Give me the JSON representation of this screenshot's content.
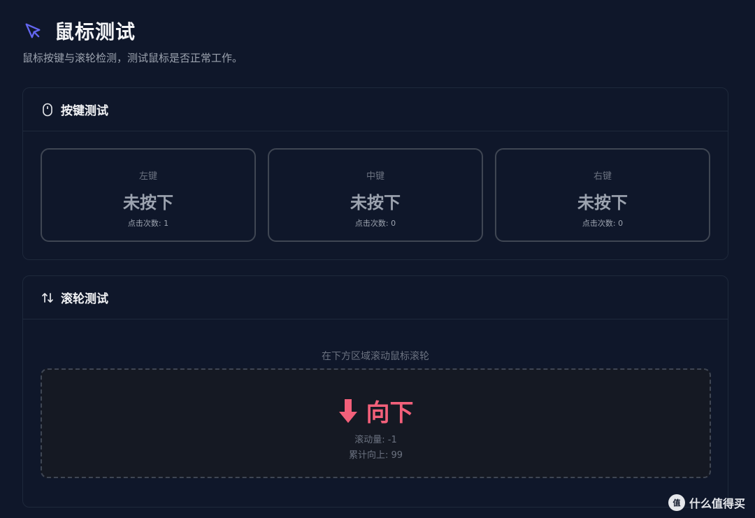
{
  "header": {
    "icon": "cursor-arrow-icon",
    "title": "鼠标测试",
    "subtitle": "鼠标按键与滚轮检测，测试鼠标是否正常工作。"
  },
  "button_test": {
    "icon": "mouse-icon",
    "title": "按键测试",
    "buttons": [
      {
        "name": "左键",
        "state": "未按下",
        "count": "点击次数: 1"
      },
      {
        "name": "中键",
        "state": "未按下",
        "count": "点击次数: 0"
      },
      {
        "name": "右键",
        "state": "未按下",
        "count": "点击次数: 0"
      }
    ]
  },
  "wheel_test": {
    "icon": "up-down-arrows-icon",
    "title": "滚轮测试",
    "hint": "在下方区域滚动鼠标滚轮",
    "direction_icon": "arrow-down-icon",
    "direction": "向下",
    "delta": "滚动量: -1",
    "total": "累计向上: 99"
  },
  "watermark": {
    "logo_text": "值",
    "text": "什么值得买"
  },
  "colors": {
    "background": "#0f172a",
    "accent": "#6366f1",
    "direction": "#f3607a"
  }
}
